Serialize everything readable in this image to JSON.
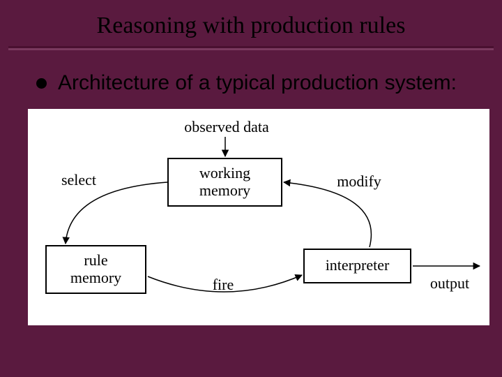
{
  "slide": {
    "title": "Reasoning with production rules",
    "subtitle": "Architecture of a typical production system:"
  },
  "diagram": {
    "observed_data": "observed data",
    "working_memory": "working\nmemory",
    "rule_memory": "rule\nmemory",
    "interpreter": "interpreter",
    "select": "select",
    "modify": "modify",
    "fire": "fire",
    "output": "output"
  }
}
